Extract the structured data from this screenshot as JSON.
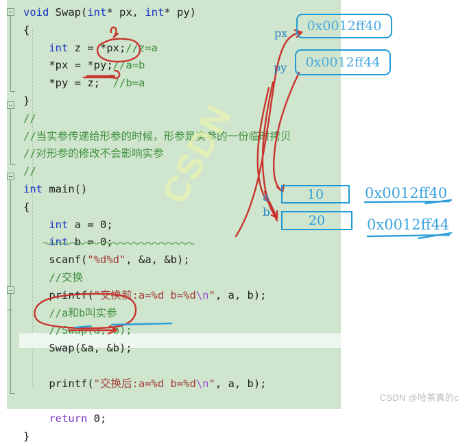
{
  "editor": {
    "language": "c",
    "theme_background": "#cfe5cd",
    "keyword_color": "#1432c8",
    "comment_color": "#3f8f3f",
    "string_color": "#a33b3b",
    "current_line_background": "#eef7ee",
    "code_lines": [
      {
        "n": 1,
        "indent": 0,
        "tokens": [
          {
            "t": "void",
            "c": "kw"
          },
          {
            "t": " Swap(",
            "c": "pl"
          },
          {
            "t": "int",
            "c": "kw"
          },
          {
            "t": "* px, ",
            "c": "pl"
          },
          {
            "t": "int",
            "c": "kw"
          },
          {
            "t": "* py)",
            "c": "pl"
          }
        ]
      },
      {
        "n": 2,
        "indent": 0,
        "tokens": [
          {
            "t": "{",
            "c": "pl"
          }
        ]
      },
      {
        "n": 3,
        "indent": 1,
        "tokens": [
          {
            "t": "int",
            "c": "kw"
          },
          {
            "t": " z = *px;",
            "c": "pl"
          },
          {
            "t": "//z=a",
            "c": "cm"
          }
        ]
      },
      {
        "n": 4,
        "indent": 1,
        "tokens": [
          {
            "t": "*px = *py;",
            "c": "pl"
          },
          {
            "t": "//a=b",
            "c": "cm"
          }
        ]
      },
      {
        "n": 5,
        "indent": 1,
        "tokens": [
          {
            "t": "*py = z;  ",
            "c": "pl"
          },
          {
            "t": "//b=a",
            "c": "cm"
          }
        ]
      },
      {
        "n": 6,
        "indent": 0,
        "tokens": [
          {
            "t": "}",
            "c": "pl"
          }
        ]
      },
      {
        "n": 7,
        "indent": 0,
        "tokens": [
          {
            "t": "//",
            "c": "cm"
          }
        ]
      },
      {
        "n": 8,
        "indent": 0,
        "tokens": [
          {
            "t": "//当实参传递给形参的时候，形参是实参的一份临时拷贝",
            "c": "cm"
          }
        ]
      },
      {
        "n": 9,
        "indent": 0,
        "tokens": [
          {
            "t": "//对形参的修改不会影响实参",
            "c": "cm"
          }
        ]
      },
      {
        "n": 10,
        "indent": 0,
        "tokens": [
          {
            "t": "//",
            "c": "cm"
          }
        ]
      },
      {
        "n": 11,
        "indent": 0,
        "tokens": [
          {
            "t": "int",
            "c": "kw"
          },
          {
            "t": " main()",
            "c": "pl"
          }
        ]
      },
      {
        "n": 12,
        "indent": 0,
        "tokens": [
          {
            "t": "{",
            "c": "pl"
          }
        ]
      },
      {
        "n": 13,
        "indent": 1,
        "tokens": [
          {
            "t": "int",
            "c": "kw"
          },
          {
            "t": " a = 0;",
            "c": "pl"
          }
        ]
      },
      {
        "n": 14,
        "indent": 1,
        "tokens": [
          {
            "t": "int",
            "c": "kw"
          },
          {
            "t": " b = 0;",
            "c": "pl"
          }
        ]
      },
      {
        "n": 15,
        "indent": 1,
        "tokens": [
          {
            "t": "scanf(",
            "c": "pl"
          },
          {
            "t": "\"%d%d\"",
            "c": "st"
          },
          {
            "t": ", &a, &b);",
            "c": "pl"
          }
        ]
      },
      {
        "n": 16,
        "indent": 1,
        "tokens": [
          {
            "t": "//交换",
            "c": "cm"
          }
        ]
      },
      {
        "n": 17,
        "indent": 1,
        "tokens": [
          {
            "t": "printf(",
            "c": "pl"
          },
          {
            "t": "\"交换前:a=%d b=%d",
            "c": "st"
          },
          {
            "t": "\\n",
            "c": "esc"
          },
          {
            "t": "\"",
            "c": "st"
          },
          {
            "t": ", a, b);",
            "c": "pl"
          }
        ]
      },
      {
        "n": 18,
        "indent": 1,
        "tokens": [
          {
            "t": "//a和b叫实参",
            "c": "cm"
          }
        ]
      },
      {
        "n": 19,
        "indent": 1,
        "tokens": [
          {
            "t": "//Swap(a, b);",
            "c": "cm"
          }
        ]
      },
      {
        "n": 20,
        "indent": 1,
        "tokens": [
          {
            "t": "Swap(&a, &b);",
            "c": "pl"
          }
        ]
      },
      {
        "n": 21,
        "indent": 1,
        "tokens": [
          {
            "t": "",
            "c": "pl"
          }
        ]
      },
      {
        "n": 22,
        "indent": 1,
        "tokens": [
          {
            "t": "printf(",
            "c": "pl"
          },
          {
            "t": "\"交换后:a=%d b=%d",
            "c": "st"
          },
          {
            "t": "\\n",
            "c": "esc"
          },
          {
            "t": "\"",
            "c": "st"
          },
          {
            "t": ", a, b);",
            "c": "pl"
          }
        ]
      },
      {
        "n": 23,
        "indent": 1,
        "tokens": [
          {
            "t": "",
            "c": "pl"
          }
        ]
      },
      {
        "n": 24,
        "indent": 1,
        "tokens": [
          {
            "t": "return",
            "c": "kw2"
          },
          {
            "t": " 0;",
            "c": "pl"
          }
        ]
      },
      {
        "n": 25,
        "indent": 0,
        "tokens": [
          {
            "t": "}",
            "c": "pl"
          }
        ]
      }
    ]
  },
  "annotations": {
    "ink_red": "#c8342f",
    "ink_blue": "#1f9ad6",
    "pointer_labels": [
      {
        "name": "px",
        "text": "px"
      },
      {
        "name": "py",
        "text": "py"
      }
    ],
    "pointer_boxes": [
      {
        "name": "px-address-box",
        "value": "0x0012ff40"
      },
      {
        "name": "py-address-box",
        "value": "0x0012ff44"
      }
    ],
    "variable_labels": [
      {
        "name": "a",
        "text": "a"
      },
      {
        "name": "b",
        "text": "b"
      }
    ],
    "variable_boxes": [
      {
        "name": "a-value-box",
        "value": "10"
      },
      {
        "name": "b-value-box",
        "value": "20"
      }
    ],
    "variable_addresses": [
      {
        "name": "a-address",
        "value": "0x0012ff40"
      },
      {
        "name": "b-address",
        "value": "0x0012ff44"
      }
    ]
  },
  "watermarks": {
    "corner": "CSDN @哈茶真的c",
    "diagonal": "CSDN"
  }
}
